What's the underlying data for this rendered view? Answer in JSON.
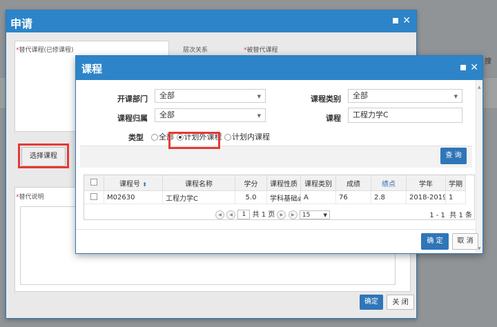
{
  "background": {
    "peek_text": "搜"
  },
  "outer_dialog": {
    "title": "申请",
    "replaced_course_label": "替代课程(已修课程)",
    "level_label": "层次关系",
    "replacing_course_label": "被替代课程",
    "select_course_button": "选择课程",
    "explanation_label": "替代说明",
    "confirm_button": "确定",
    "close_button": "关 闭",
    "required_mark": "*"
  },
  "course_dialog": {
    "title": "课程",
    "filters": {
      "dept_label": "开课部门",
      "dept_value": "全部",
      "category_label": "课程类别",
      "category_value": "全部",
      "owner_label": "课程归属",
      "owner_value": "全部",
      "course_label": "课程",
      "course_value": "工程力学C",
      "type_label": "类型",
      "type_options": [
        "全部",
        "计划外课程",
        "计划内课程"
      ],
      "type_selected": "计划外课程"
    },
    "search_button": "查 询",
    "table": {
      "columns": [
        "课程号",
        "课程名称",
        "学分",
        "课程性质",
        "课程类别",
        "成绩",
        "绩点",
        "学年",
        "学期"
      ],
      "rows": [
        [
          "M02630",
          "工程力学C",
          "5.0",
          "学科基础必",
          "A",
          "76",
          "2.8",
          "2018-2019",
          "1"
        ]
      ]
    },
    "pager": {
      "page": "1",
      "total_pages": "共 1 页",
      "page_size": "15",
      "range": "1 - 1",
      "total": "共 1 条"
    },
    "ok_button": "确 定",
    "cancel_button": "取 消"
  },
  "colors": {
    "primary": "#2d84c8",
    "highlight": "#e53935"
  },
  "icons": [
    "maximize-icon",
    "close-icon",
    "sort-icon",
    "caret-down-icon",
    "first-page-icon",
    "prev-page-icon",
    "next-page-icon",
    "last-page-icon"
  ]
}
